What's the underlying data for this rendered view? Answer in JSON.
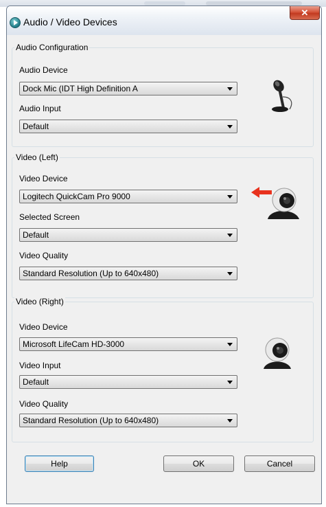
{
  "window": {
    "title": "Audio / Video Devices",
    "close_glyph": "✕"
  },
  "audio": {
    "legend": "Audio Configuration",
    "device_label": "Audio Device",
    "device_value": "Dock Mic (IDT High Definition A",
    "input_label": "Audio Input",
    "input_value": "Default"
  },
  "video_left": {
    "legend": "Video (Left)",
    "device_label": "Video Device",
    "device_value": "Logitech QuickCam Pro 9000",
    "screen_label": "Selected Screen",
    "screen_value": "Default",
    "quality_label": "Video Quality",
    "quality_value": "Standard Resolution (Up to 640x480)"
  },
  "video_right": {
    "legend": "Video (Right)",
    "device_label": "Video Device",
    "device_value": "Microsoft LifeCam HD-3000",
    "input_label": "Video Input",
    "input_value": "Default",
    "quality_label": "Video Quality",
    "quality_value": "Standard Resolution (Up to 640x480)"
  },
  "buttons": {
    "help": "Help",
    "ok": "OK",
    "cancel": "Cancel"
  },
  "colors": {
    "arrow": "#e8321e",
    "close": "#c23a20",
    "group_border": "#d5dfe5"
  }
}
